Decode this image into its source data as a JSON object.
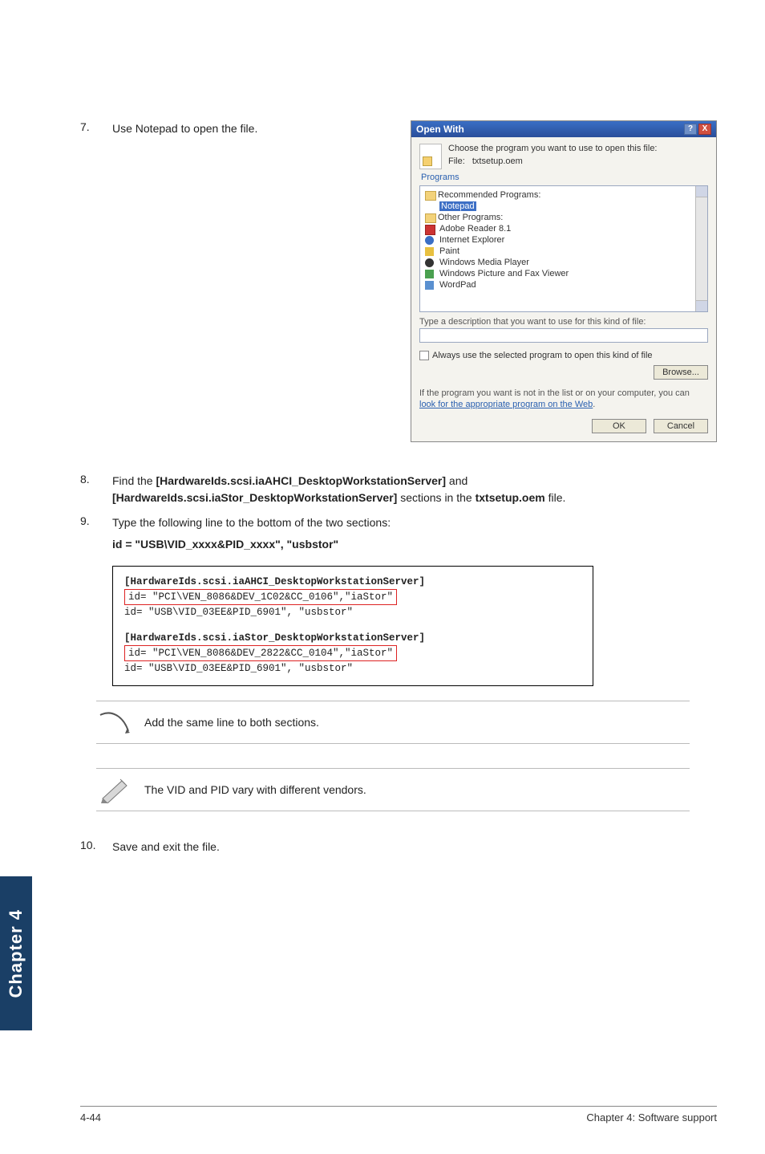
{
  "steps": {
    "s7_num": "7.",
    "s7_text": "Use Notepad to open the file.",
    "s8_num": "8.",
    "s8_text_a": "Find the ",
    "s8_text_b": "[HardwareIds.scsi.iaAHCI_DesktopWorkstationServer]",
    "s8_text_c": " and ",
    "s8_text_d": "[HardwareIds.scsi.iaStor_DesktopWorkstationServer]",
    "s8_text_e": " sections in the ",
    "s8_text_f": "txtsetup.oem",
    "s8_text_g": " file.",
    "s9_num": "9.",
    "s9_text": "Type the following line to the bottom of the two sections:",
    "s9_code": "id = \"USB\\VID_xxxx&PID_xxxx\", \"usbstor\"",
    "s10_num": "10.",
    "s10_text": "Save and exit the file."
  },
  "dialog": {
    "title": "Open With",
    "help": "?",
    "close": "X",
    "top_line": "Choose the program you want to use to open this file:",
    "file_lbl": "File:",
    "file_name": "txtsetup.oem",
    "programs_lbl": "Programs",
    "rec_head": "Recommended Programs:",
    "rec_notepad": "Notepad",
    "other_head": "Other Programs:",
    "p_adobe": "Adobe Reader 8.1",
    "p_ie": "Internet Explorer",
    "p_paint": "Paint",
    "p_wmp": "Windows Media Player",
    "p_fax": "Windows Picture and Fax Viewer",
    "p_wordpad": "WordPad",
    "descr_lbl": "Type a description that you want to use for this kind of file:",
    "chk_lbl": "Always use the selected program to open this kind of file",
    "browse": "Browse...",
    "link_a": "If the program you want is not in the list or on your computer, you can ",
    "link_b": "look for the appropriate program on the Web",
    "link_c": ".",
    "ok": "OK",
    "cancel": "Cancel"
  },
  "codebox": {
    "l1": "[HardwareIds.scsi.iaAHCI_DesktopWorkstationServer]",
    "l2": "id= \"PCI\\VEN_8086&DEV_1C02&CC_0106\",\"iaStor\"",
    "l3": "id= \"USB\\VID_03EE&PID_6901\", \"usbstor\"",
    "l4": "[HardwareIds.scsi.iaStor_DesktopWorkstationServer]",
    "l5": "id= \"PCI\\VEN_8086&DEV_2822&CC_0104\",\"iaStor\"",
    "l6": "id= \"USB\\VID_03EE&PID_6901\", \"usbstor\""
  },
  "notes": {
    "n1": "Add the same line to both sections.",
    "n2": "The VID and PID vary with different vendors."
  },
  "side_tab": "Chapter 4",
  "footer": {
    "left": "4-44",
    "right": "Chapter 4: Software support"
  }
}
